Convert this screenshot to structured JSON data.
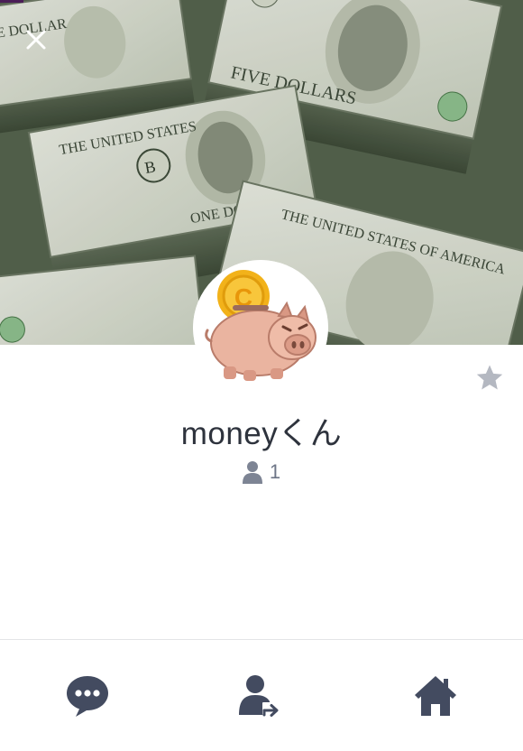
{
  "header": {
    "close_icon": "close-icon",
    "cover_image": "stacks-of-us-dollar-bills"
  },
  "profile": {
    "name": "moneyくん",
    "friend_count": "1",
    "avatar_image": "piggy-bank-with-gold-coin",
    "favorite_icon": "star-icon"
  },
  "bottom_bar": {
    "items": [
      {
        "icon": "chat-bubble-icon"
      },
      {
        "icon": "share-contact-icon"
      },
      {
        "icon": "home-icon"
      }
    ]
  },
  "colors": {
    "text_primary": "#2e333d",
    "text_secondary": "#6e7687",
    "icon_dark": "#434b60",
    "star_gray": "#b4b8c1",
    "coin_gold": "#f2b21a",
    "pig_pink": "#eab4a0"
  }
}
